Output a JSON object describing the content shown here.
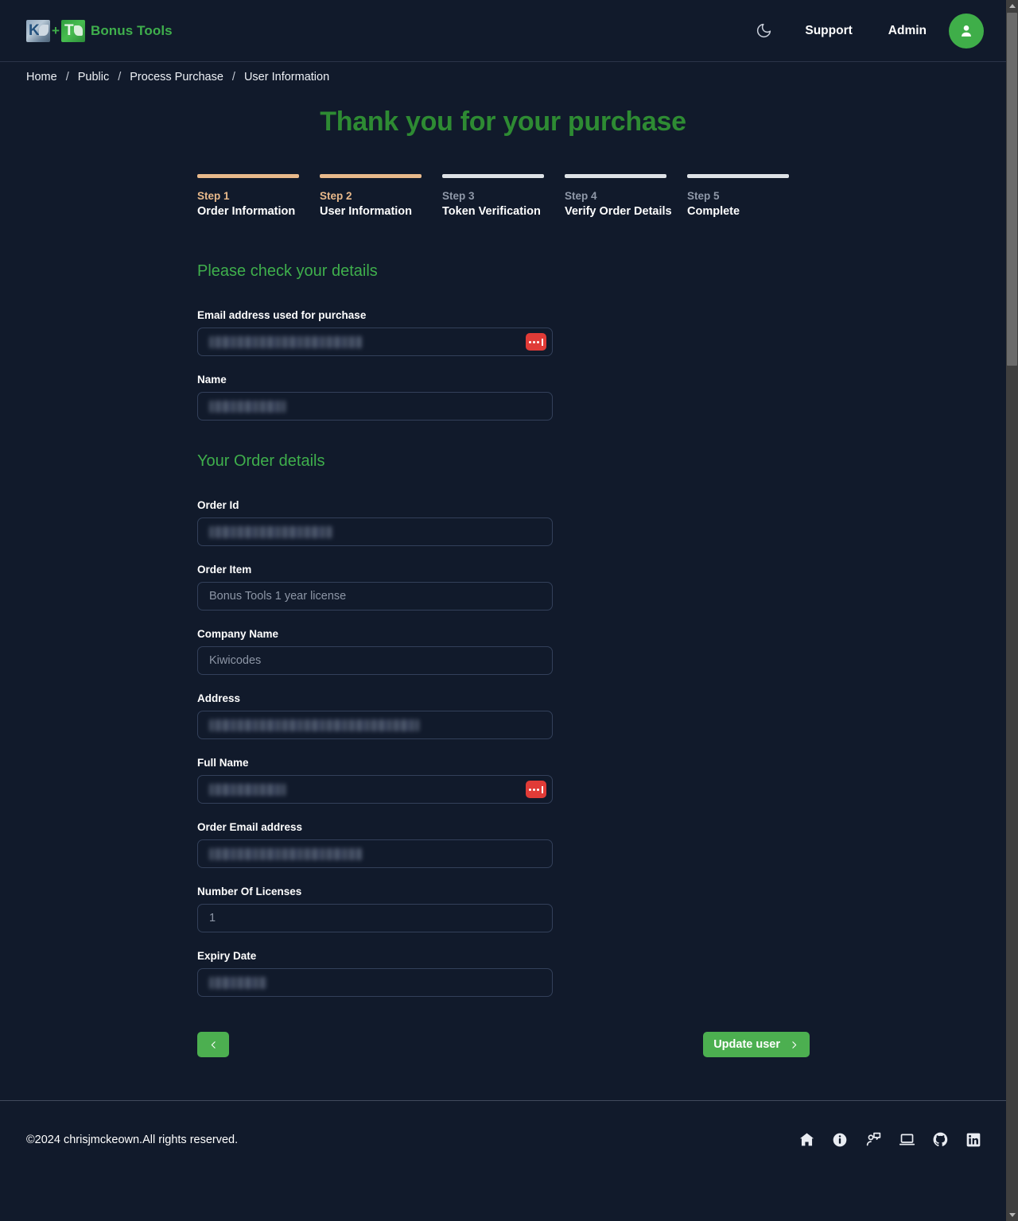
{
  "header": {
    "brand": "Bonus Tools",
    "logo_left_icon": "kiwicodes-k-logo",
    "logo_plus": "+",
    "logo_right_icon": "bonus-tools-t-logo",
    "theme_toggle_icon": "moon-icon",
    "support_label": "Support",
    "admin_label": "Admin",
    "avatar_icon": "user-avatar-icon"
  },
  "breadcrumb": {
    "items": [
      {
        "label": "Home"
      },
      {
        "label": "Public"
      },
      {
        "label": "Process Purchase"
      },
      {
        "label": "User Information"
      }
    ],
    "separator": "/"
  },
  "main": {
    "title": "Thank you for your purchase",
    "stepper": [
      {
        "num": "Step 1",
        "label": "Order Information",
        "state": "active"
      },
      {
        "num": "Step 2",
        "label": "User Information",
        "state": "active"
      },
      {
        "num": "Step 3",
        "label": "Token Verification",
        "state": "inactive"
      },
      {
        "num": "Step 4",
        "label": "Verify Order Details",
        "state": "inactive"
      },
      {
        "num": "Step 5",
        "label": "Complete",
        "state": "inactive"
      }
    ],
    "section_details": "Please check your details",
    "section_order": "Your Order details",
    "fields": {
      "purchase_email": {
        "label": "Email address used for purchase",
        "value": "",
        "redacted": true,
        "has_password_badge": true
      },
      "name": {
        "label": "Name",
        "value": "",
        "redacted": true,
        "has_password_badge": false
      },
      "order_id": {
        "label": "Order Id",
        "value": "",
        "redacted": true,
        "has_password_badge": false
      },
      "order_item": {
        "label": "Order Item",
        "value": "Bonus Tools 1 year license",
        "redacted": false,
        "has_password_badge": false
      },
      "company_name": {
        "label": "Company Name",
        "value": "Kiwicodes",
        "redacted": false,
        "has_password_badge": false
      },
      "address": {
        "label": "Address",
        "value": "",
        "redacted": true,
        "has_password_badge": false
      },
      "full_name": {
        "label": "Full Name",
        "value": "",
        "redacted": true,
        "has_password_badge": true
      },
      "order_email": {
        "label": "Order Email address",
        "value": "",
        "redacted": true,
        "has_password_badge": false
      },
      "licenses": {
        "label": "Number Of Licenses",
        "value": "1",
        "redacted": false,
        "has_password_badge": false
      },
      "expiry_date": {
        "label": "Expiry Date",
        "value": "",
        "redacted": true,
        "has_password_badge": false
      }
    },
    "buttons": {
      "back_icon": "chevron-left-icon",
      "update_label": "Update user",
      "update_icon": "chevron-right-icon"
    },
    "password_badge_icon": "password-manager-icon"
  },
  "footer": {
    "copyright": "©2024 chrisjmckeown.All rights reserved.",
    "icons": [
      {
        "name": "home-icon"
      },
      {
        "name": "info-icon"
      },
      {
        "name": "contact-icon"
      },
      {
        "name": "laptop-icon"
      },
      {
        "name": "github-icon"
      },
      {
        "name": "linkedin-icon"
      }
    ]
  },
  "colors": {
    "page_bg": "#111a2b",
    "brand_green": "#3faf4c",
    "title_green": "#2e8b33",
    "step_active": "#e8b98b",
    "step_inactive": "#dee2e6",
    "button_green": "#4caf50",
    "badge_red": "#e03b37"
  }
}
